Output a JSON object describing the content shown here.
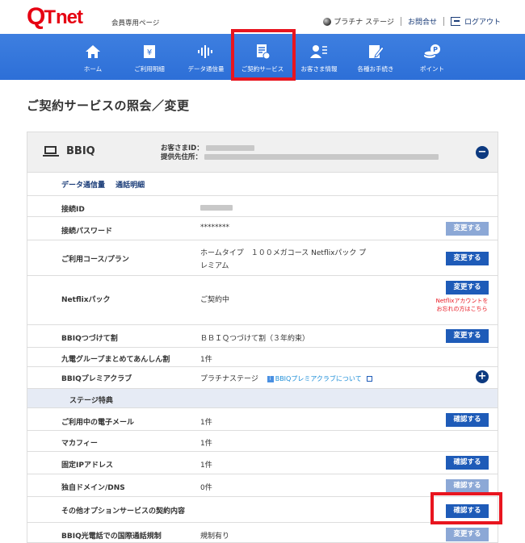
{
  "header": {
    "logo": "QTnet",
    "member_page": "会員専用ページ",
    "plan": "プラチナ ステージ",
    "contact": "お問合せ",
    "logout": "ログアウト"
  },
  "nav": [
    {
      "label": "ホーム",
      "icon": "home-icon"
    },
    {
      "label": "ご利用明細",
      "icon": "bill-icon"
    },
    {
      "label": "データ通信量",
      "icon": "waveform-icon"
    },
    {
      "label": "ご契約サービス",
      "icon": "contract-icon"
    },
    {
      "label": "お客さま情報",
      "icon": "user-info-icon"
    },
    {
      "label": "各種お手続き",
      "icon": "edit-icon"
    },
    {
      "label": "ポイント",
      "icon": "coin-icon"
    }
  ],
  "page_title": "ご契約サービスの照会／変更",
  "card": {
    "service": "BBIQ",
    "customer_id_label": "お客さまID：",
    "address_label": "提供先住所：",
    "links": [
      "データ通信量",
      "通話明細"
    ],
    "rows": [
      {
        "label": "接続ID",
        "value": "",
        "button": ""
      },
      {
        "label": "接続パスワード",
        "value": "********",
        "button": "変更する"
      },
      {
        "label": "ご利用コース/プラン",
        "value": "ホームタイプ　１００メガコース Netflixパック プ",
        "value2": "レミアム",
        "button": "変更する"
      },
      {
        "label": "Netflixパック",
        "value": "ご契約中",
        "button": "変更する",
        "note1": "Netflixアカウントを",
        "note2": "お忘れの方はこちら"
      },
      {
        "label": "BBIQつづけて割",
        "value": "ＢＢＩＱつづけて割（３年約束）",
        "button": "変更する"
      },
      {
        "label": "九電グループまとめてあんしん割",
        "value": "1件",
        "button": ""
      },
      {
        "label": "BBIQプレミアクラブ",
        "value": "プラチナステージ",
        "link": "BBIQプレミアクラブについて",
        "button": ""
      },
      {
        "label": "ステージ特典",
        "value": "",
        "button": ""
      },
      {
        "label": "ご利用中の電子メール",
        "value": "1件",
        "button": "確認する"
      },
      {
        "label": "マカフィー",
        "value": "1件",
        "button": ""
      },
      {
        "label": "固定IPアドレス",
        "value": "1件",
        "button": "確認する"
      },
      {
        "label": "独自ドメイン/DNS",
        "value": "0件",
        "button": "確認する"
      },
      {
        "label": "その他オプションサービスの契約内容",
        "value": "",
        "button": "確認する"
      },
      {
        "label": "BBIQ光電話での国際通話規制",
        "value": "規制有り",
        "button": "変更する"
      }
    ]
  }
}
